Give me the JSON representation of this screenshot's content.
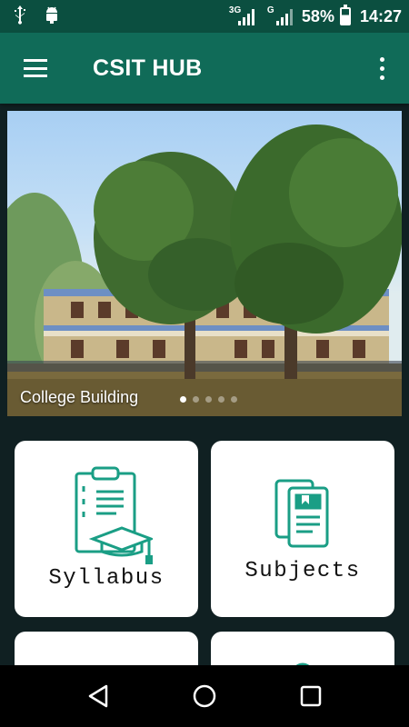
{
  "status_bar": {
    "network_3g": "3G",
    "network_g": "G",
    "battery_percent": "58%",
    "time": "14:27"
  },
  "app_bar": {
    "title": "CSIT HUB"
  },
  "banner": {
    "caption": "College Building",
    "slide_count": 5,
    "active_slide": 0
  },
  "cards": [
    {
      "label": "Syllabus",
      "icon": "syllabus-clipboard-icon"
    },
    {
      "label": "Subjects",
      "icon": "subjects-books-icon"
    }
  ],
  "colors": {
    "status_bar": "#0b4f40",
    "app_bar": "#106b58",
    "background": "#102022",
    "accent": "#1a9e85"
  }
}
